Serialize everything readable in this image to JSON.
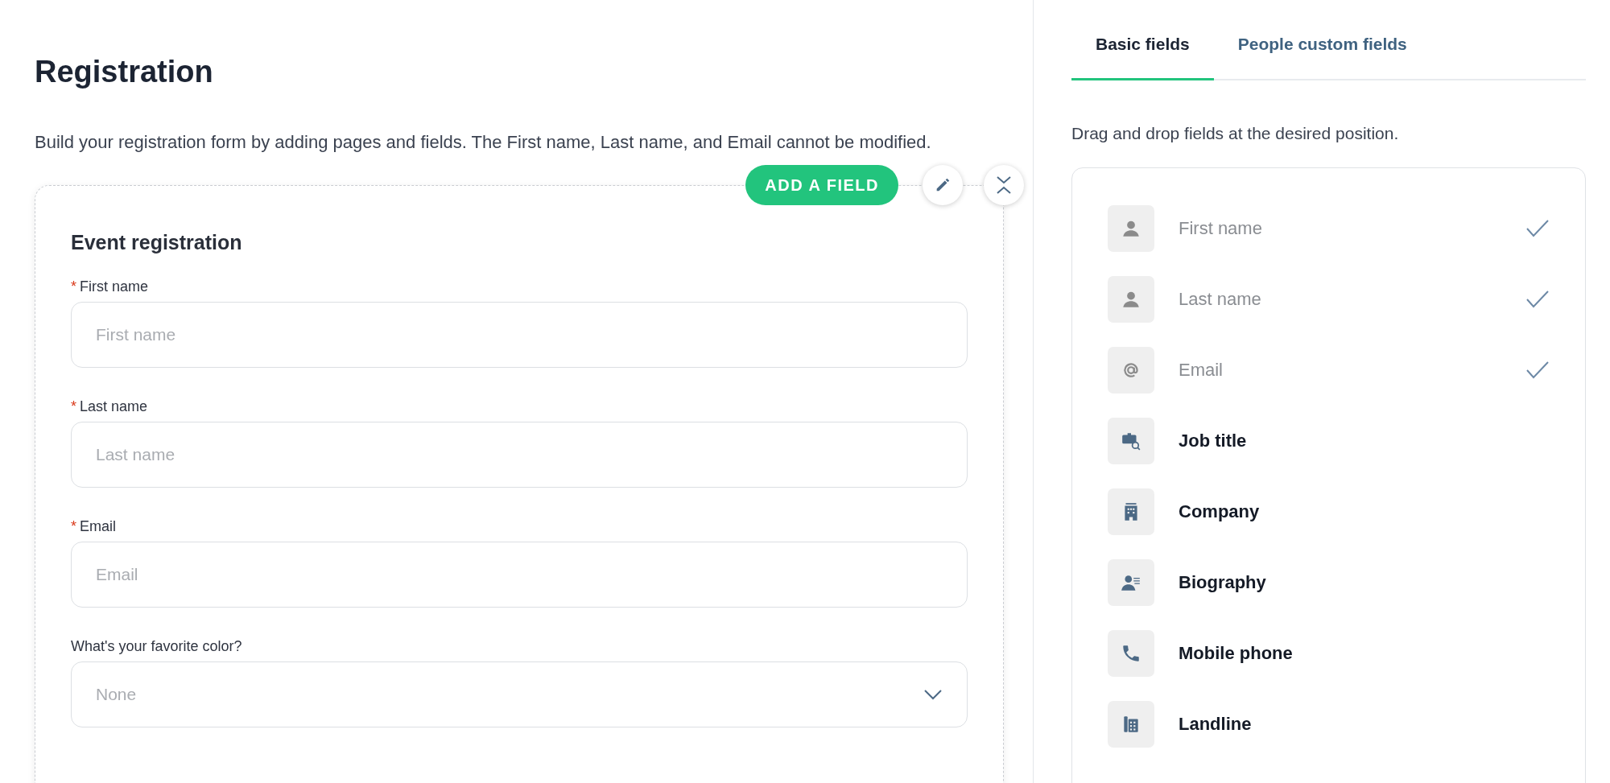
{
  "page": {
    "title": "Registration",
    "description": "Build your registration form by adding pages and fields. The First name, Last name, and Email cannot be modified."
  },
  "form_card": {
    "add_button": "ADD A FIELD",
    "title": "Event registration",
    "fields": [
      {
        "kind": "text",
        "required_mark": "*",
        "label": "First name",
        "placeholder": "First name"
      },
      {
        "kind": "text",
        "required_mark": "*",
        "label": "Last name",
        "placeholder": "Last name"
      },
      {
        "kind": "text",
        "required_mark": "*",
        "label": "Email",
        "placeholder": "Email"
      },
      {
        "kind": "select",
        "label": "What's your favorite color?",
        "placeholder": "None"
      }
    ]
  },
  "side_panel": {
    "tabs": [
      {
        "label": "Basic fields",
        "selected": true
      },
      {
        "label": "People custom fields",
        "selected": false
      }
    ],
    "hint": "Drag and drop fields at the desired position.",
    "items": [
      {
        "kind": "person",
        "label": "First name",
        "added": true
      },
      {
        "kind": "person",
        "label": "Last name",
        "added": true
      },
      {
        "kind": "email",
        "label": "Email",
        "added": true
      },
      {
        "kind": "job",
        "label": "Job title",
        "added": false
      },
      {
        "kind": "company",
        "label": "Company",
        "added": false
      },
      {
        "kind": "bio",
        "label": "Biography",
        "added": false
      },
      {
        "kind": "mobile",
        "label": "Mobile phone",
        "added": false
      },
      {
        "kind": "landline",
        "label": "Landline",
        "added": false
      }
    ]
  }
}
